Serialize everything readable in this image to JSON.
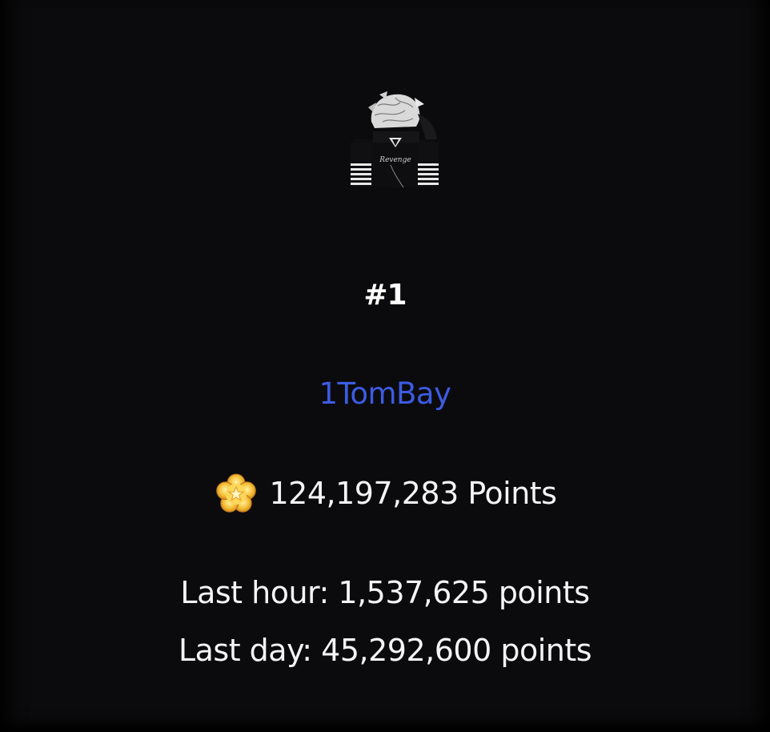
{
  "leaderboard_entry": {
    "rank": "#1",
    "username": "1TomBay",
    "points_label": "124,197,283 Points",
    "last_hour": "Last hour: 1,537,625 points",
    "last_day": "Last day: 45,292,600 points"
  },
  "icons": {
    "points": "star-flower-icon",
    "avatar": "player-avatar"
  },
  "colors": {
    "background": "#0b0b0d",
    "username": "#3d5be2",
    "text": "#f4f4f4"
  }
}
